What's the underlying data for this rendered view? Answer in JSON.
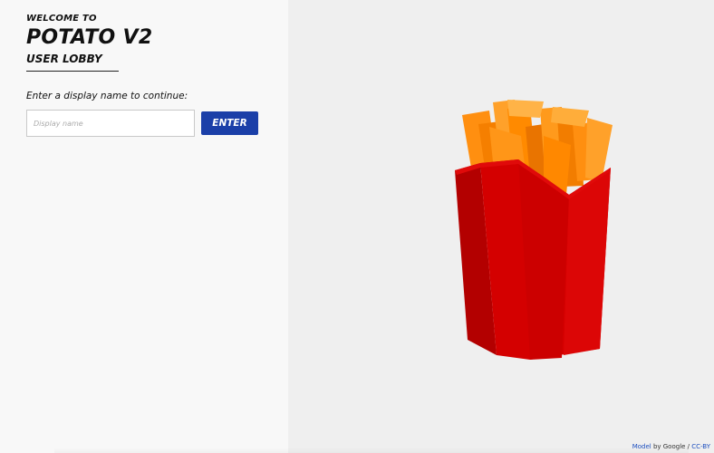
{
  "lobby": {
    "welcome_label": "WELCOME TO",
    "app_name": "POTATO V2",
    "subtitle": "USER LOBBY",
    "prompt": "Enter a display name to continue:",
    "input_placeholder": "Display name",
    "input_value": "",
    "enter_label": "ENTER"
  },
  "viewer": {
    "model_subject": "french-fries-model",
    "credit": {
      "model_link": "Model",
      "by_text": " by Google / ",
      "license_link": "CC-BY"
    }
  },
  "colors": {
    "panel_bg": "#f8f8f8",
    "viewer_bg": "#efefef",
    "button_bg": "#1b3fa8",
    "fries_box_red": "#d40000",
    "fries_orange": "#ff8a00",
    "link_blue": "#1d4fbf"
  }
}
